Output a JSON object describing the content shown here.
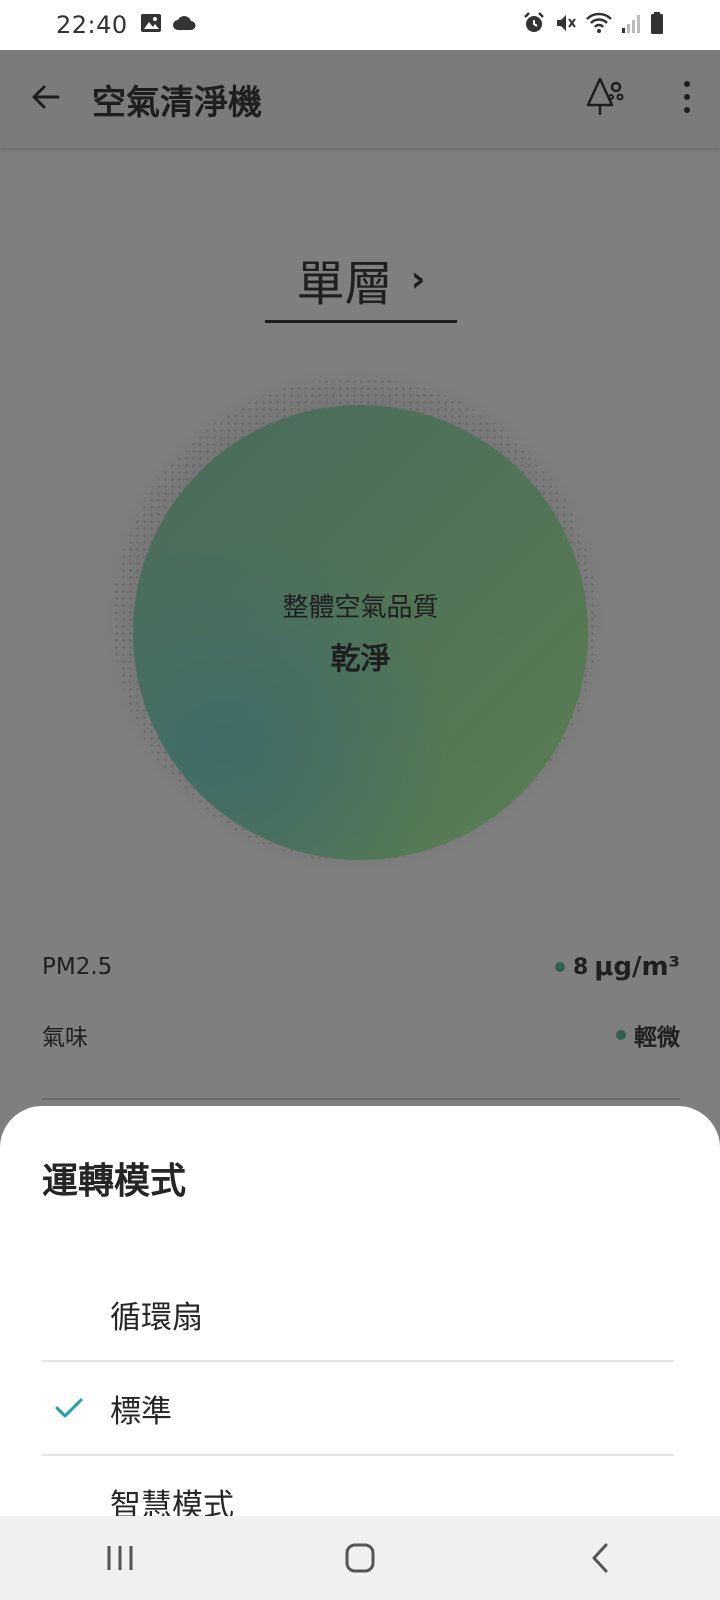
{
  "status_bar": {
    "time": "22:40"
  },
  "app_bar": {
    "title": "空氣清淨機"
  },
  "room": {
    "name": "單層"
  },
  "air_quality": {
    "label": "整體空氣品質",
    "value": "乾淨",
    "color": "#527456"
  },
  "metrics": [
    {
      "name": "PM2.5",
      "value": "8",
      "unit": "μg/m³"
    },
    {
      "name": "氣味",
      "value": "輕微"
    }
  ],
  "sheet": {
    "title": "運轉模式",
    "options": [
      {
        "label": "循環扇",
        "selected": false
      },
      {
        "label": "標準",
        "selected": true
      },
      {
        "label": "智慧模式",
        "selected": false
      }
    ],
    "check_color": "#1aa0b0"
  }
}
